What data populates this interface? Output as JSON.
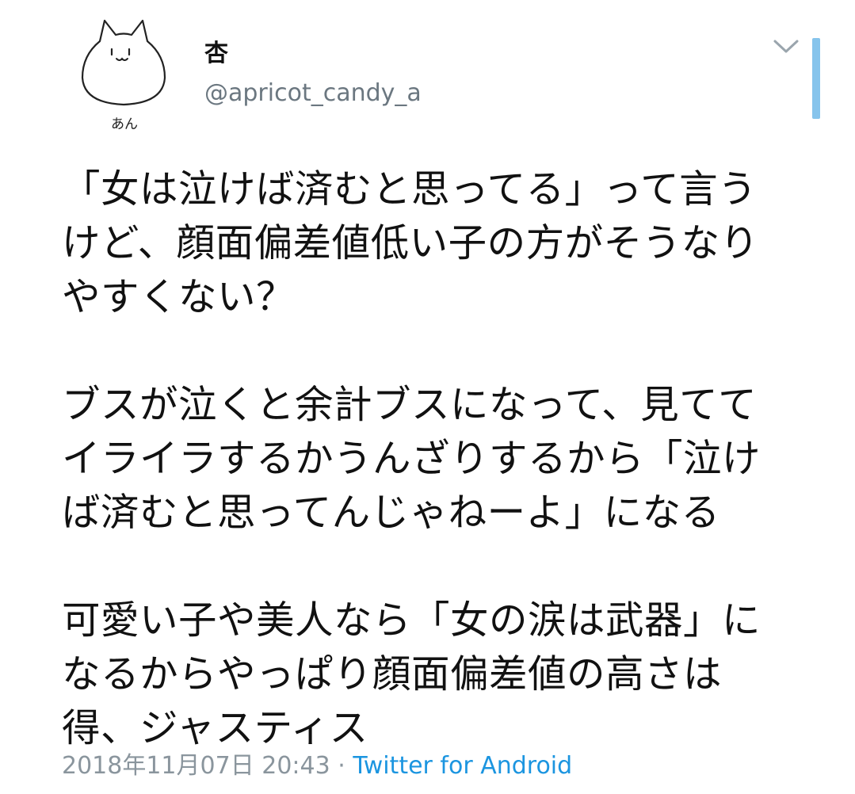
{
  "user": {
    "display_name": "杏",
    "handle": "@apricot_candy_a",
    "avatar_caption": "あん"
  },
  "tweet": {
    "paragraphs": [
      [
        "「女は泣けば済むと思ってる」って言う",
        "けど、顔面偏差値低い子の方がそうなり",
        "やすくない？"
      ],
      [
        "ブスが泣くと余計ブスになって、見てて",
        "イライラするかうんざりするから「泣け",
        "ば済むと思ってんじゃねーよ」になる"
      ],
      [
        "可愛い子や美人なら「女の涙は武器」に",
        "なるからやっぱり顔面偏差値の高さは",
        "得、ジャスティス"
      ]
    ],
    "timestamp": "2018年11月07日 20:43",
    "separator": "·",
    "source": "Twitter for Android"
  },
  "icons": {
    "menu": "chevron-down-icon",
    "avatar": "cat-drawing-avatar"
  },
  "colors": {
    "text": "#111111",
    "secondary": "#6b7780",
    "link": "#1b95e0",
    "scroll_indicator": "#86c4ec"
  }
}
